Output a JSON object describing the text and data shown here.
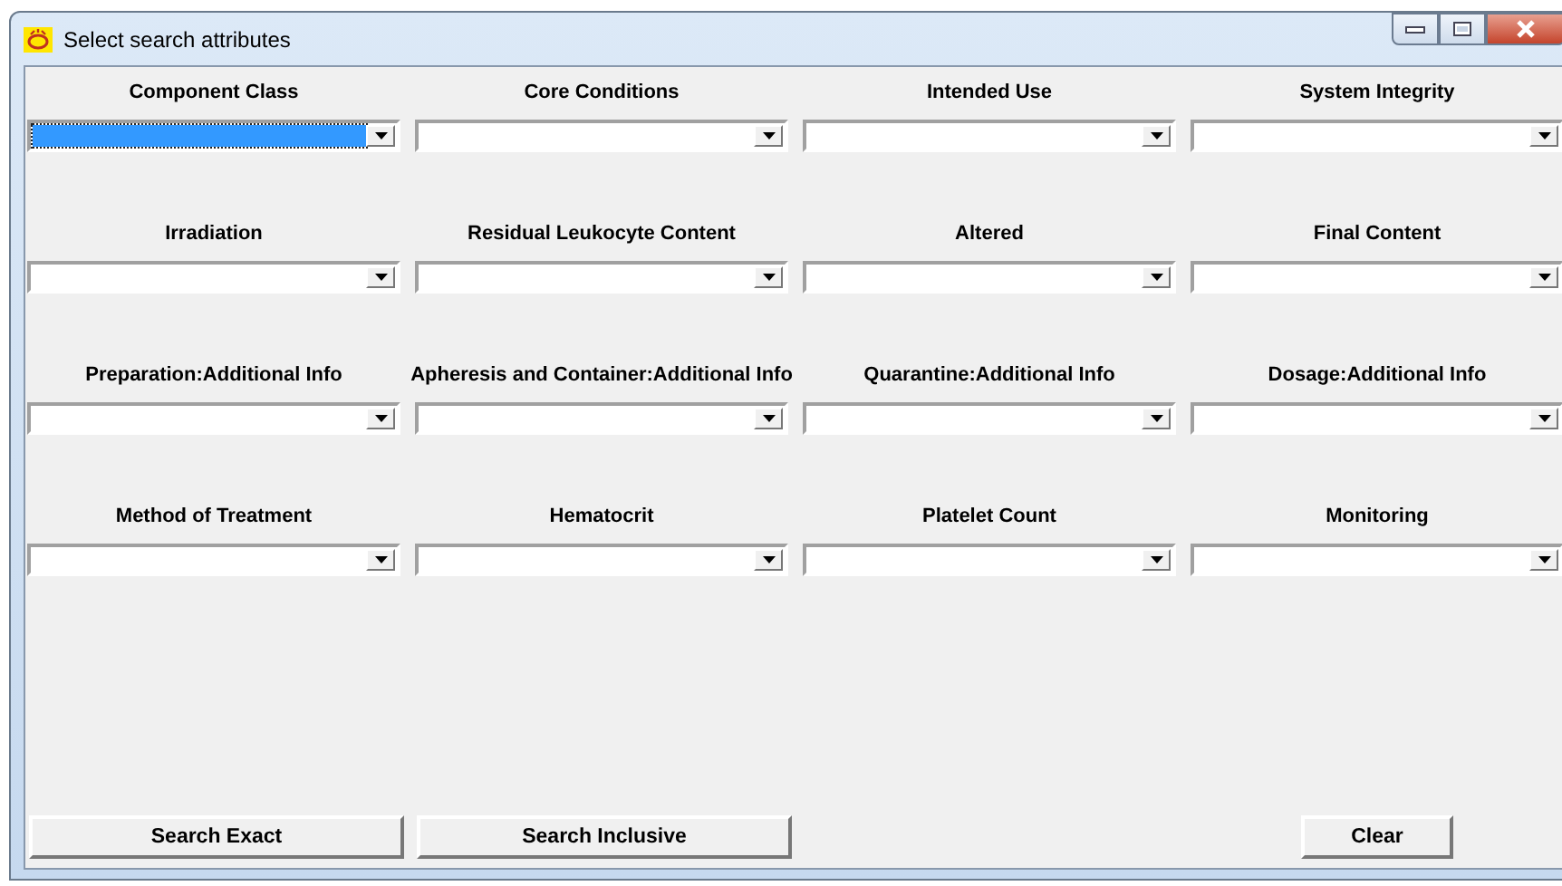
{
  "window": {
    "title": "Select search attributes"
  },
  "fields": [
    {
      "label": "Component Class",
      "selected": true
    },
    {
      "label": "Core Conditions",
      "selected": false
    },
    {
      "label": "Intended Use",
      "selected": false
    },
    {
      "label": "System Integrity",
      "selected": false
    },
    {
      "label": "Irradiation",
      "selected": false
    },
    {
      "label": "Residual Leukocyte Content",
      "selected": false
    },
    {
      "label": "Altered",
      "selected": false
    },
    {
      "label": "Final Content",
      "selected": false
    },
    {
      "label": "Preparation:Additional Info",
      "selected": false
    },
    {
      "label": "Apheresis and Container:Additional Info",
      "selected": false
    },
    {
      "label": "Quarantine:Additional Info",
      "selected": false
    },
    {
      "label": "Dosage:Additional Info",
      "selected": false
    },
    {
      "label": "Method of Treatment",
      "selected": false
    },
    {
      "label": "Hematocrit",
      "selected": false
    },
    {
      "label": "Platelet Count",
      "selected": false
    },
    {
      "label": "Monitoring",
      "selected": false
    }
  ],
  "buttons": [
    {
      "label": "Search Exact",
      "kind": "left"
    },
    {
      "label": "Search Inclusive",
      "kind": "left"
    },
    {
      "label": "Clear",
      "kind": "right"
    }
  ]
}
